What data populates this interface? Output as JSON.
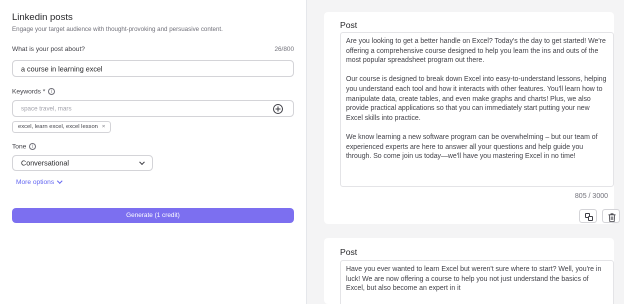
{
  "app": {
    "title": "Linkedin posts",
    "subtitle": "Engage your target audience with thought-provoking and persuasive content."
  },
  "form": {
    "topic_label": "What is your post about?",
    "topic_counter": "26/800",
    "topic_value": "a course in learning excel",
    "keywords_label": "Keywords *",
    "keywords_placeholder": "space travel, mars",
    "keywords_chip": "excel, learn excel, excel lesson",
    "tone_label": "Tone",
    "tone_value": "Conversational",
    "more_options_label": "More options",
    "generate_label": "Generate (1 credit)"
  },
  "posts": [
    {
      "title": "Post",
      "paragraphs": [
        "Are you looking to get a better handle on Excel? Today's the day to get started! We're offering a comprehensive course designed to help you learn the ins and outs of the most popular spreadsheet program out there.",
        "Our course is designed to break down Excel into easy-to-understand lessons, helping you understand each tool and how it interacts with other features. You'll learn how to manipulate data, create tables, and even make graphs and charts! Plus, we also provide practical applications so that you can immediately start putting your new Excel skills into practice.",
        "We know learning a new software program can be overwhelming – but our team of experienced experts are here to answer all your questions and help guide you through. So come join us today—we'll have you mastering Excel in no time!"
      ],
      "char_count": "805 / 3000"
    },
    {
      "title": "Post",
      "paragraphs": [
        "Have you ever wanted to learn Excel but weren't sure where to start? Well, you're in luck! We are now offering a course to help you not just understand the basics of Excel, but also become an expert in it"
      ]
    }
  ],
  "icons": {
    "info": "info-icon",
    "add": "plus-circle-icon",
    "copy": "copy-icon",
    "delete": "trash-icon",
    "chevron": "chevron-down-icon"
  },
  "colors": {
    "accent": "#7c6ff0",
    "link": "#6366f1",
    "panel_bg": "#f4f4f5"
  }
}
